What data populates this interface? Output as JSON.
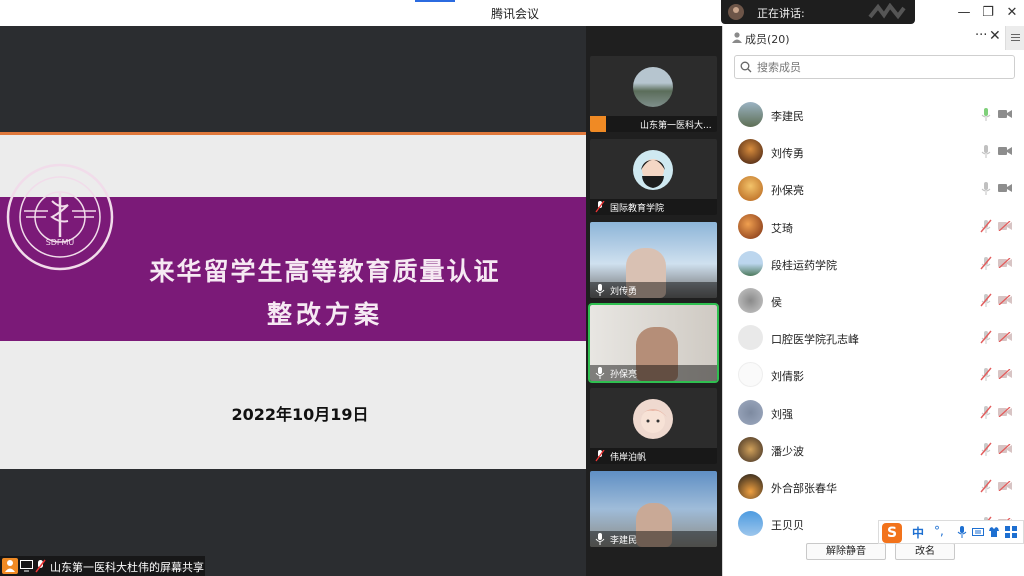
{
  "window": {
    "title": "腾讯会议",
    "speaking_label": "正在讲话:",
    "controls": {
      "minimize": "—",
      "restore": "❐",
      "close": "✕"
    }
  },
  "slide": {
    "title": "来华留学生高等教育质量认证",
    "subtitle": "整改方案",
    "date": "2022年10月19日",
    "seal_text": "SDFMU",
    "band_color": "#7b1a78",
    "accent_color": "#e0793c"
  },
  "share_label": "山东第一医科大杜伟的屏幕共享",
  "gallery": [
    {
      "name": "山东第一医科大..."
    },
    {
      "name": "国际教育学院"
    },
    {
      "name": "刘传勇"
    },
    {
      "name": "孙保亮"
    },
    {
      "name": "伟岸泊帆"
    },
    {
      "name": "李建民"
    }
  ],
  "panel": {
    "title": "成员(20)",
    "more": "···",
    "close": "✕",
    "search_placeholder": "搜索成员",
    "members": [
      {
        "name": "李建民",
        "mic": "on"
      },
      {
        "name": "刘传勇",
        "mic": "on"
      },
      {
        "name": "孙保亮",
        "mic": "on"
      },
      {
        "name": "艾琦",
        "mic": "muted"
      },
      {
        "name": "段桂运药学院",
        "mic": "muted"
      },
      {
        "name": "侯",
        "mic": "muted"
      },
      {
        "name": "口腔医学院孔志峰",
        "mic": "muted"
      },
      {
        "name": "刘倩影",
        "mic": "muted"
      },
      {
        "name": "刘强",
        "mic": "muted"
      },
      {
        "name": "潘少波",
        "mic": "muted"
      },
      {
        "name": "外合部张春华",
        "mic": "muted"
      },
      {
        "name": "王贝贝",
        "mic": "muted"
      }
    ],
    "unmute_label": "解除静音",
    "rename_label": "改名"
  },
  "ime": {
    "logo": "S",
    "mode": "中",
    "punct": "°,"
  }
}
